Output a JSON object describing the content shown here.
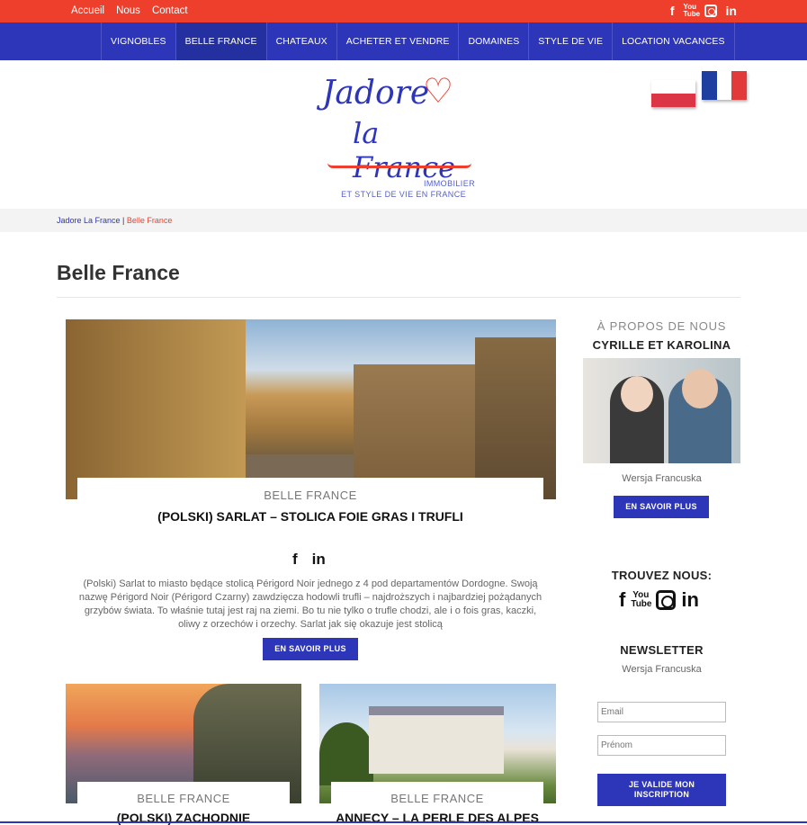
{
  "topbar": {
    "links": [
      "Accueil",
      "Nous",
      "Contact"
    ],
    "social": [
      "facebook-icon",
      "youtube-icon",
      "instagram-icon",
      "linkedin-icon"
    ]
  },
  "nav": {
    "items": [
      "VIGNOBLES",
      "BELLE FRANCE",
      "CHATEAUX",
      "ACHETER ET VENDRE",
      "DOMAINES",
      "STYLE DE VIE",
      "LOCATION VACANCES"
    ],
    "active": "BELLE FRANCE"
  },
  "logo": {
    "line1": "Jadore",
    "line2": "la France",
    "tagline1": "IMMOBILIER",
    "tagline2": "ET STYLE DE VIE EN FRANCE"
  },
  "breadcrumb": {
    "home": "Jadore La France",
    "sep": " | ",
    "current": "Belle France"
  },
  "page": {
    "title": "Belle France"
  },
  "featured": {
    "category": "BELLE FRANCE",
    "title": "(POLSKI) SARLAT – STOLICA FOIE GRAS I TRUFLI",
    "excerpt": "(Polski) Sarlat to miasto będące stolicą Périgord Noir jednego z 4 pod departamentów Dordogne. Swoją nazwę Périgord Noir (Périgord Czarny) zawdzięcza hodowli trufli – najdroższych i najbardziej pożądanych grzybów świata. To właśnie tutaj jest raj na ziemi. Bo tu nie tylko o trufle chodzi, ale i o fois gras, kaczki, oliwy z orzechów i orzechy. Sarlat jak się okazuje jest stolicą",
    "button": "EN SAVOIR PLUS"
  },
  "cards": [
    {
      "category": "BELLE FRANCE",
      "title": "(POLSKI) ZACHODNIE"
    },
    {
      "category": "BELLE FRANCE",
      "title": "ANNECY – LA PERLE DES ALPES"
    }
  ],
  "sidebar": {
    "about_heading": "À PROPOS DE NOUS",
    "about_names": "CYRILLE ET KAROLINA",
    "about_lang": "Wersja Francuska",
    "about_button": "EN SAVOIR PLUS",
    "find_heading": "TROUVEZ NOUS:",
    "newsletter_heading": "NEWSLETTER",
    "newsletter_lang": "Wersja Francuska",
    "email_placeholder": "Email",
    "name_placeholder": "Prénom",
    "submit_line1": "JE VALIDE MON",
    "submit_line2": "INSCRIPTION"
  },
  "colors": {
    "red": "#ee3f2c",
    "blue": "#2d35b8",
    "flag_fr": [
      "#1f3fa0",
      "#ffffff",
      "#e23a3a"
    ]
  }
}
